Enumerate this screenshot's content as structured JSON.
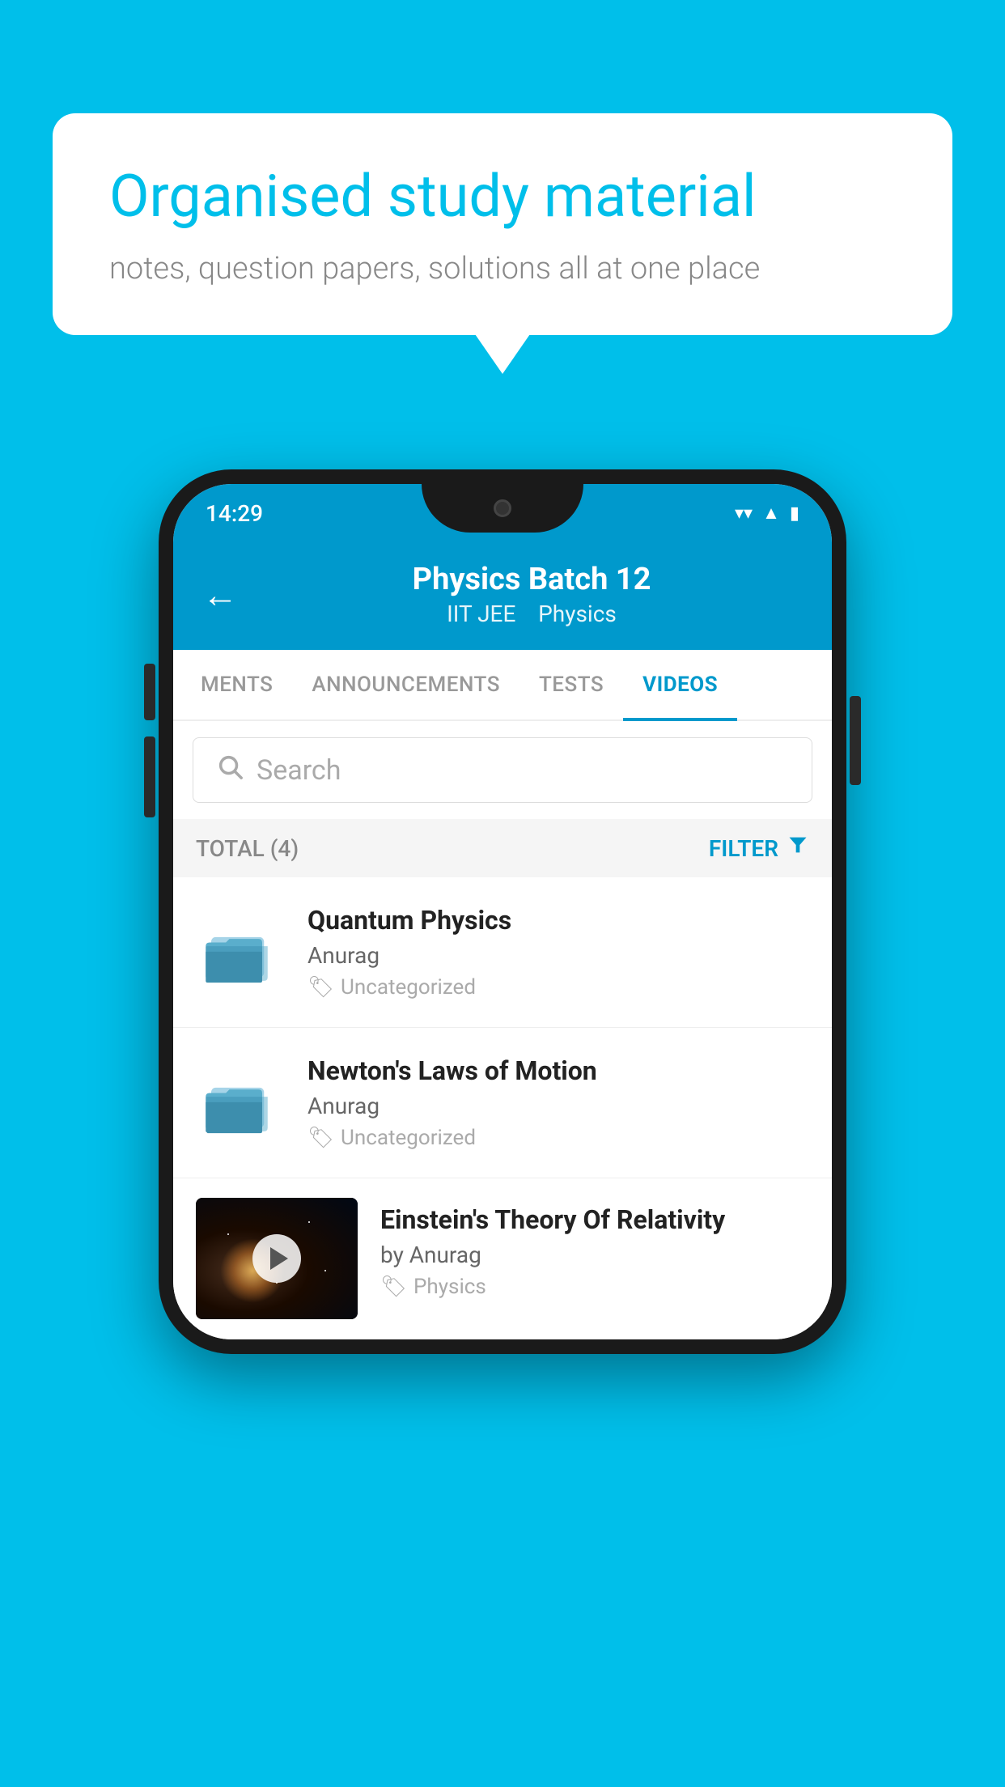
{
  "background_color": "#00BFEA",
  "bubble": {
    "title": "Organised study material",
    "subtitle": "notes, question papers, solutions all at one place"
  },
  "phone": {
    "status_bar": {
      "time": "14:29",
      "icons": [
        "wifi",
        "signal",
        "battery"
      ]
    },
    "toolbar": {
      "title": "Physics Batch 12",
      "subtitle_part1": "IIT JEE",
      "subtitle_part2": "Physics",
      "back_label": "←"
    },
    "tabs": [
      {
        "label": "MENTS",
        "active": false
      },
      {
        "label": "ANNOUNCEMENTS",
        "active": false
      },
      {
        "label": "TESTS",
        "active": false
      },
      {
        "label": "VIDEOS",
        "active": true
      }
    ],
    "search": {
      "placeholder": "Search"
    },
    "filter": {
      "total_label": "TOTAL (4)",
      "filter_label": "FILTER"
    },
    "videos": [
      {
        "title": "Quantum Physics",
        "author": "Anurag",
        "tag": "Uncategorized",
        "type": "folder",
        "thumbnail": null
      },
      {
        "title": "Newton's Laws of Motion",
        "author": "Anurag",
        "tag": "Uncategorized",
        "type": "folder",
        "thumbnail": null
      },
      {
        "title": "Einstein's Theory Of Relativity",
        "author": "by Anurag",
        "tag": "Physics",
        "type": "video",
        "thumbnail": "space"
      }
    ]
  }
}
